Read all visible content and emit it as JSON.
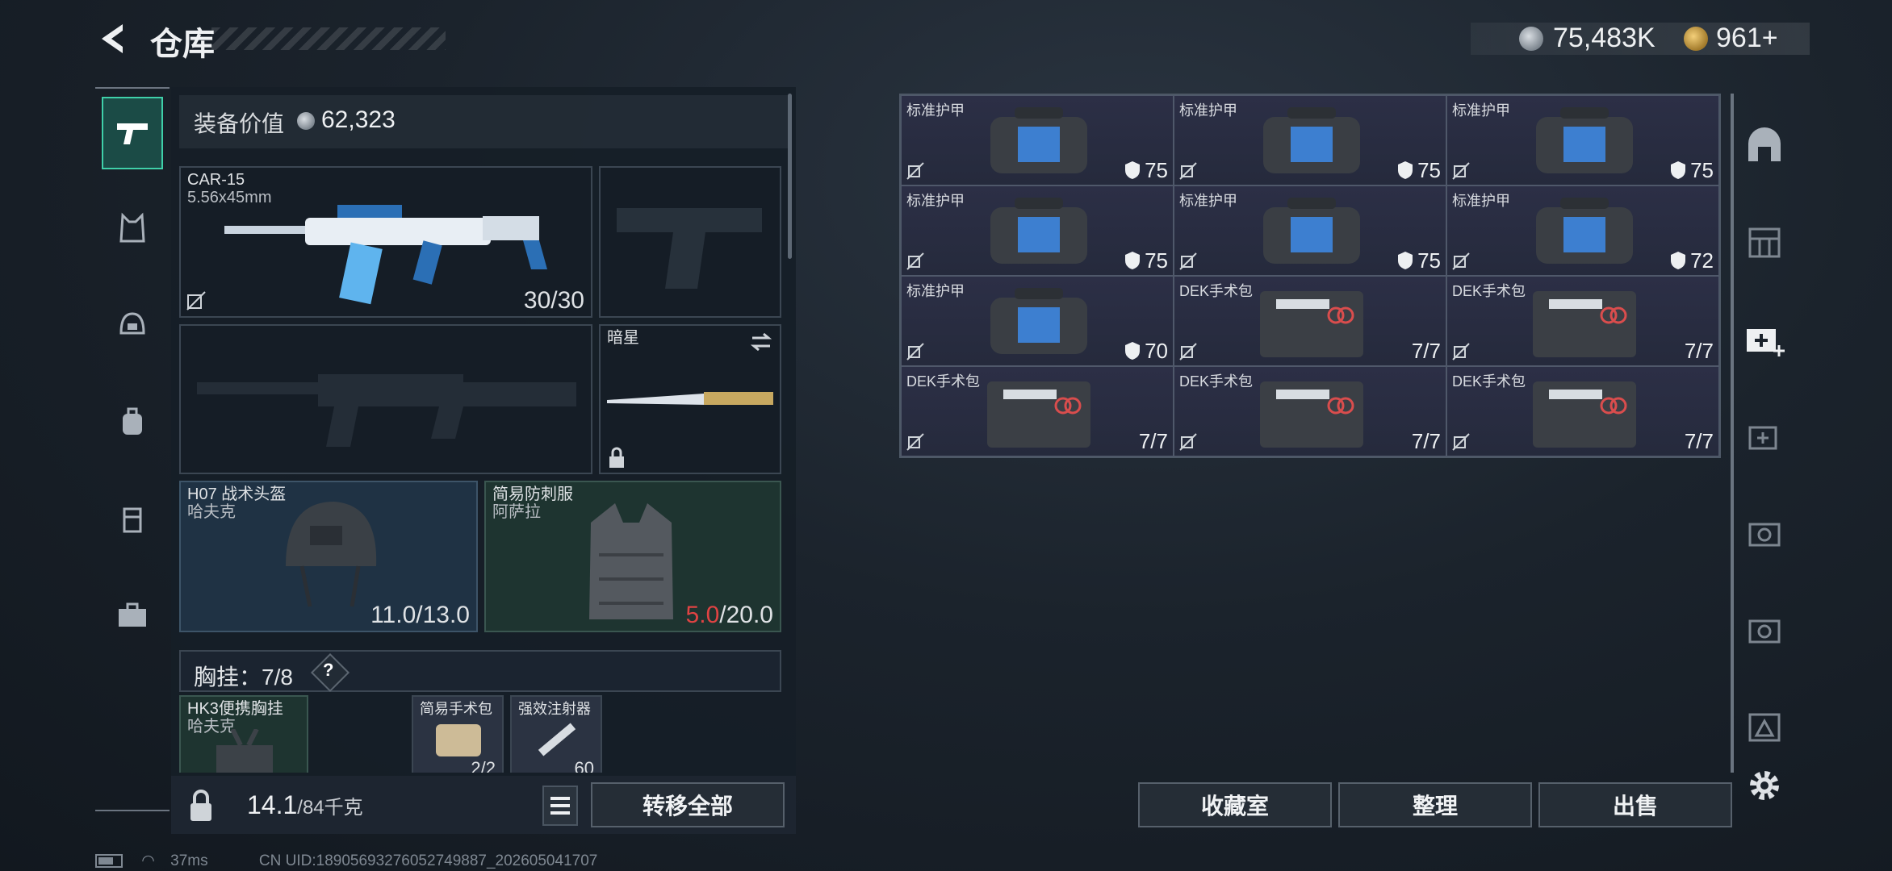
{
  "header": {
    "title": "仓库",
    "coins": "75,483K",
    "tokens": "961+"
  },
  "equipment": {
    "label": "装备价值",
    "value": "62,323",
    "primary": {
      "name": "CAR-15",
      "ammo_type": "5.56x45mm",
      "ammo": "30/30"
    },
    "melee": {
      "name": "暗星"
    },
    "helmet": {
      "name": "H07 战术头盔",
      "brand": "哈夫克",
      "durability_current": "11.0",
      "durability_max": "/13.0"
    },
    "armor": {
      "name": "简易防刺服",
      "brand": "阿萨拉",
      "durability_current": "5.0",
      "durability_max": "/20.0"
    },
    "chest_rig": {
      "label": "胸挂：",
      "count": "7/8",
      "help": "?"
    },
    "rig_name": "HK3便携胸挂",
    "rig_brand": "哈夫克",
    "small_items": [
      {
        "name": "简易手术包",
        "value": "2/2"
      },
      {
        "name": "强效注射器",
        "value": "60"
      }
    ]
  },
  "footer": {
    "weight": "14.1",
    "weight_max": "/84千克",
    "transfer_all": "转移全部",
    "collection": "收藏室",
    "organize": "整理",
    "sell": "出售"
  },
  "grid": {
    "items": [
      {
        "name": "标准护甲",
        "value": "75",
        "kind": "armor"
      },
      {
        "name": "标准护甲",
        "value": "75",
        "kind": "armor"
      },
      {
        "name": "标准护甲",
        "value": "75",
        "kind": "armor"
      },
      {
        "name": "标准护甲",
        "value": "75",
        "kind": "armor"
      },
      {
        "name": "标准护甲",
        "value": "75",
        "kind": "armor"
      },
      {
        "name": "标准护甲",
        "value": "72",
        "kind": "armor"
      },
      {
        "name": "标准护甲",
        "value": "70",
        "kind": "armor"
      },
      {
        "name": "DEK手术包",
        "value": "7/7",
        "kind": "medkit"
      },
      {
        "name": "DEK手术包",
        "value": "7/7",
        "kind": "medkit"
      },
      {
        "name": "DEK手术包",
        "value": "7/7",
        "kind": "medkit"
      },
      {
        "name": "DEK手术包",
        "value": "7/7",
        "kind": "medkit"
      },
      {
        "name": "DEK手术包",
        "value": "7/7",
        "kind": "medkit"
      }
    ]
  },
  "status": {
    "ping": "37ms",
    "uid": "CN UID:18905693276052749887_202605041707"
  },
  "colors": {
    "accent": "#3fd0a9",
    "warning": "#e04343"
  }
}
